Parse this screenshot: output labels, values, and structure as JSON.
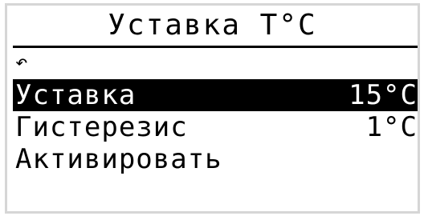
{
  "screen": {
    "title": "Уставка T°C",
    "back_icon": "undo-arrow-icon",
    "back_glyph": "↶"
  },
  "menu": {
    "items": [
      {
        "label": "Уставка",
        "value": "15°C",
        "selected": true
      },
      {
        "label": "Гистерезис",
        "value": "1°C",
        "selected": false
      },
      {
        "label": "Активировать",
        "value": "",
        "selected": false
      }
    ]
  },
  "colors": {
    "background": "#ffffff",
    "foreground": "#000000",
    "highlight": "#000000",
    "frame": "#d6d6d6"
  }
}
